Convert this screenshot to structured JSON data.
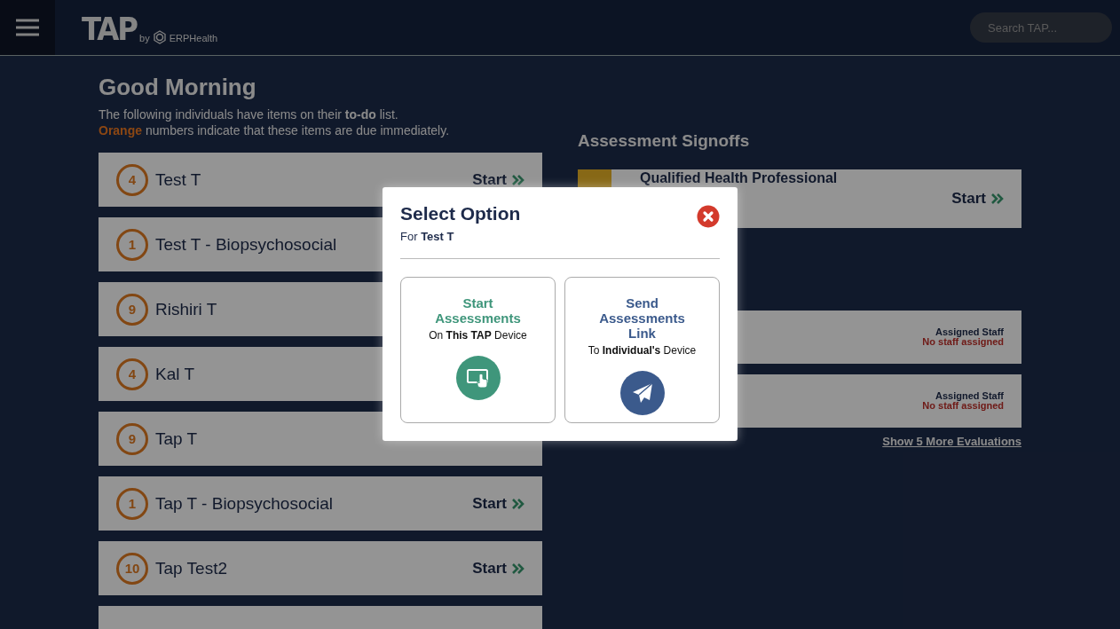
{
  "header": {
    "logo": "TAP",
    "logo_by": "by",
    "logo_brand": "ERPHealth",
    "search": {
      "placeholder": "Search TAP..."
    }
  },
  "greeting": {
    "title": "Good Morning",
    "line_1": "The following individuals have items on their **to-do** list.",
    "line_2": "**Orange** numbers indicate that these items are due immediately."
  },
  "todo": [
    {
      "count": "4",
      "name": "Test T",
      "start": "Start"
    },
    {
      "count": "1",
      "name": "Test T - Biopsychosocial"
    },
    {
      "count": "9",
      "name": "Rishiri T"
    },
    {
      "count": "4",
      "name": "Kal T"
    },
    {
      "count": "9",
      "name": "Tap T"
    },
    {
      "count": "1",
      "name": "Tap T - Biopsychosocial",
      "start": "Start"
    },
    {
      "count": "10",
      "name": "Tap Test2",
      "start": "Start"
    },
    {
      "kind": "cut"
    }
  ],
  "signoffs": {
    "title": "Assessment Signoffs",
    "card": {
      "title": "Qualified Health Professional",
      "start": "Start"
    }
  },
  "evaluations": [
    {
      "label": "Assigned Staff",
      "value": "No staff assigned"
    },
    {
      "label": "Assigned Staff",
      "value": "No staff assigned"
    }
  ],
  "more_link": "Show 5 More Evaluations",
  "modal": {
    "title": "Select Option",
    "subtitle": "For **Test T**",
    "options": [
      {
        "kind": "local",
        "title": "Start Assessments",
        "caption": "On **This TAP** Device"
      },
      {
        "kind": "send",
        "title": "Send Assessments Link",
        "caption": "To **Individual's** Device"
      }
    ]
  }
}
